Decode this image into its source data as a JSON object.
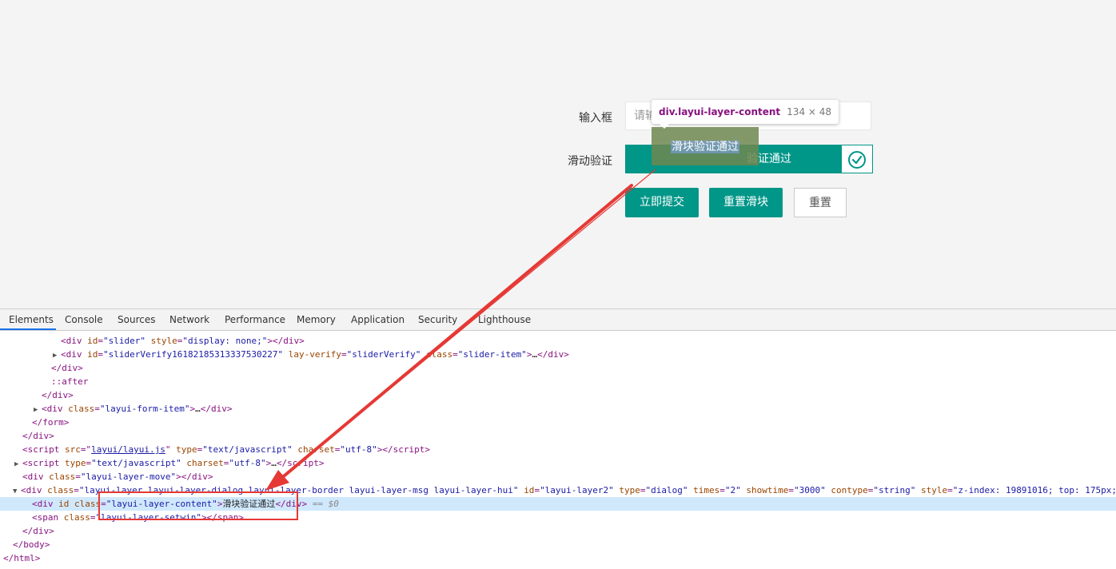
{
  "form": {
    "input_label": "输入框",
    "input_placeholder": "请输入",
    "slider_label": "滑动验证",
    "slider_text": "验证通过",
    "submit_button": "立即提交",
    "reset_slider_button": "重置滑块",
    "reset_button": "重置"
  },
  "layer": {
    "message": "滑块验证通过"
  },
  "tooltip": {
    "selector": "div.layui-layer-content",
    "dimensions": "134 × 48"
  },
  "devtools": {
    "tabs": [
      "Elements",
      "Console",
      "Sources",
      "Network",
      "Performance",
      "Memory",
      "Application",
      "Security",
      "Lighthouse"
    ],
    "selected_suffix": "== $0",
    "message_text": "滑块验证通过"
  },
  "colors": {
    "accent": "#009688",
    "highlight": "#cfe8fc",
    "annotation": "#e53935"
  }
}
